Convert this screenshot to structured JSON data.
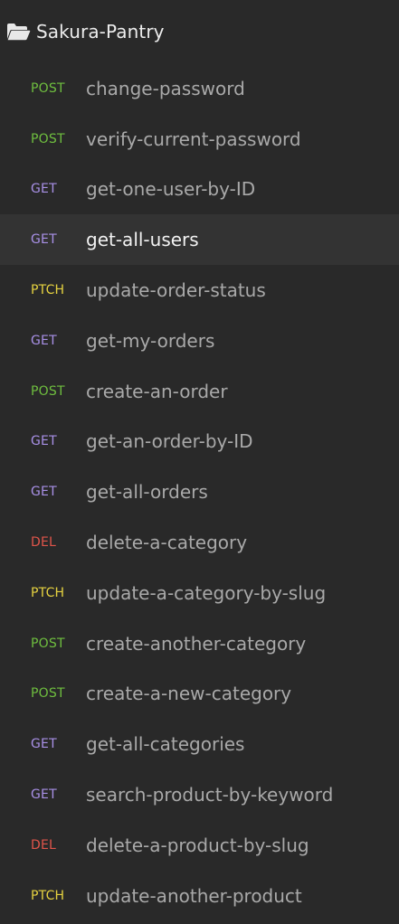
{
  "workspace": {
    "folder_name": "Sakura-Pantry",
    "folder_icon": "folder-open-icon"
  },
  "colors": {
    "background": "#292929",
    "active_row": "#333333",
    "POST": "#6fbf3f",
    "GET": "#a890e6",
    "PTCH": "#e6d240",
    "DEL": "#e0554a"
  },
  "requests": [
    {
      "method": "POST",
      "name": "change-password",
      "active": false
    },
    {
      "method": "POST",
      "name": "verify-current-password",
      "active": false
    },
    {
      "method": "GET",
      "name": "get-one-user-by-ID",
      "active": false
    },
    {
      "method": "GET",
      "name": "get-all-users",
      "active": true
    },
    {
      "method": "PTCH",
      "name": "update-order-status",
      "active": false
    },
    {
      "method": "GET",
      "name": "get-my-orders",
      "active": false
    },
    {
      "method": "POST",
      "name": "create-an-order",
      "active": false
    },
    {
      "method": "GET",
      "name": "get-an-order-by-ID",
      "active": false
    },
    {
      "method": "GET",
      "name": "get-all-orders",
      "active": false
    },
    {
      "method": "DEL",
      "name": "delete-a-category",
      "active": false
    },
    {
      "method": "PTCH",
      "name": "update-a-category-by-slug",
      "active": false
    },
    {
      "method": "POST",
      "name": "create-another-category",
      "active": false
    },
    {
      "method": "POST",
      "name": "create-a-new-category",
      "active": false
    },
    {
      "method": "GET",
      "name": "get-all-categories",
      "active": false
    },
    {
      "method": "GET",
      "name": "search-product-by-keyword",
      "active": false
    },
    {
      "method": "DEL",
      "name": "delete-a-product-by-slug",
      "active": false
    },
    {
      "method": "PTCH",
      "name": "update-another-product",
      "active": false
    }
  ]
}
